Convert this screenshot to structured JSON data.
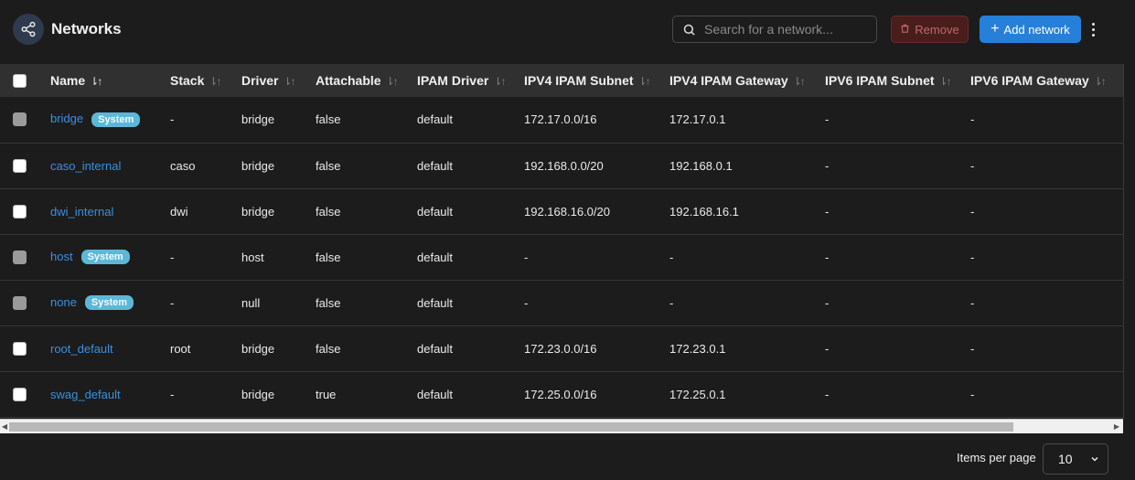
{
  "header": {
    "title": "Networks",
    "title_icon": "share-icon",
    "search_placeholder": "Search for a network...",
    "remove_label": "Remove",
    "add_label": "Add network",
    "colors": {
      "primary": "#2680d9",
      "danger": "#4a1d1d",
      "badge": "#5bb8d8",
      "link": "#3b8fe0"
    }
  },
  "table": {
    "columns": [
      "Name",
      "Stack",
      "Driver",
      "Attachable",
      "IPAM Driver",
      "IPV4 IPAM Subnet",
      "IPV4 IPAM Gateway",
      "IPV6 IPAM Subnet",
      "IPV6 IPAM Gateway"
    ],
    "sort_icon": "⇂↑",
    "badge_label": "System",
    "rows": [
      {
        "name": "bridge",
        "system": true,
        "stack": "-",
        "driver": "bridge",
        "attachable": "false",
        "ipam_driver": "default",
        "ipv4_subnet": "172.17.0.0/16",
        "ipv4_gateway": "172.17.0.1",
        "ipv6_subnet": "-",
        "ipv6_gateway": "-"
      },
      {
        "name": "caso_internal",
        "system": false,
        "stack": "caso",
        "driver": "bridge",
        "attachable": "false",
        "ipam_driver": "default",
        "ipv4_subnet": "192.168.0.0/20",
        "ipv4_gateway": "192.168.0.1",
        "ipv6_subnet": "-",
        "ipv6_gateway": "-"
      },
      {
        "name": "dwi_internal",
        "system": false,
        "stack": "dwi",
        "driver": "bridge",
        "attachable": "false",
        "ipam_driver": "default",
        "ipv4_subnet": "192.168.16.0/20",
        "ipv4_gateway": "192.168.16.1",
        "ipv6_subnet": "-",
        "ipv6_gateway": "-"
      },
      {
        "name": "host",
        "system": true,
        "stack": "-",
        "driver": "host",
        "attachable": "false",
        "ipam_driver": "default",
        "ipv4_subnet": "-",
        "ipv4_gateway": "-",
        "ipv6_subnet": "-",
        "ipv6_gateway": "-"
      },
      {
        "name": "none",
        "system": true,
        "stack": "-",
        "driver": "null",
        "attachable": "false",
        "ipam_driver": "default",
        "ipv4_subnet": "-",
        "ipv4_gateway": "-",
        "ipv6_subnet": "-",
        "ipv6_gateway": "-"
      },
      {
        "name": "root_default",
        "system": false,
        "stack": "root",
        "driver": "bridge",
        "attachable": "false",
        "ipam_driver": "default",
        "ipv4_subnet": "172.23.0.0/16",
        "ipv4_gateway": "172.23.0.1",
        "ipv6_subnet": "-",
        "ipv6_gateway": "-"
      },
      {
        "name": "swag_default",
        "system": false,
        "stack": "-",
        "driver": "bridge",
        "attachable": "true",
        "ipam_driver": "default",
        "ipv4_subnet": "172.25.0.0/16",
        "ipv4_gateway": "172.25.0.1",
        "ipv6_subnet": "-",
        "ipv6_gateway": "-"
      }
    ]
  },
  "footer": {
    "items_per_page_label": "Items per page",
    "items_per_page_value": "10"
  }
}
